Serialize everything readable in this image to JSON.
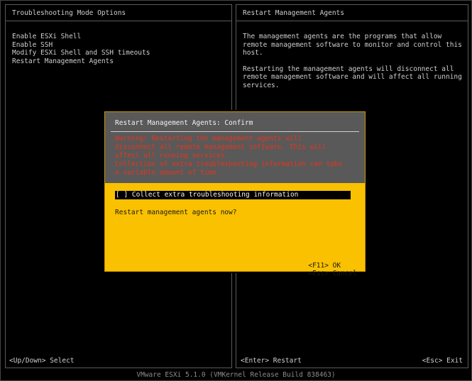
{
  "left_panel": {
    "title": "Troubleshooting Mode Options",
    "items": [
      {
        "label": "Enable ESXi Shell"
      },
      {
        "label": "Enable SSH"
      },
      {
        "label": "Modify ESXi Shell and SSH timeouts"
      },
      {
        "label": "Restart Management Agents"
      }
    ]
  },
  "right_panel": {
    "title": "Restart Management Agents",
    "paragraph1": "The management agents are the programs that allow remote management software to monitor and control this host.",
    "paragraph2": "Restarting the management agents will disconnect all remote management software and will affect all running services."
  },
  "dialog": {
    "title": "Restart Management Agents: Confirm",
    "warning1": "Warning: Restarting the management agents will disconnect all remote management software. This will affect all running services.",
    "warning2": "Collection of extra troubleshooting information can take a variable amount of time.",
    "checkbox_label": "[ ] Collect extra troubleshooting information",
    "question": "Restart management agents now?",
    "ok_label": "<F11> OK",
    "cancel_label": "<Esc> Cancel"
  },
  "status_bar": {
    "left": "<Up/Down> Select",
    "middle": "<Enter> Restart",
    "right": "<Esc> Exit"
  },
  "footer": "VMware ESXi 5.1.0 (VMKernel Release Build 838463)",
  "colors": {
    "background": "#000000",
    "dialog_yellow": "#f9c100",
    "dialog_header": "#595959",
    "warning_red": "#e8341c"
  }
}
